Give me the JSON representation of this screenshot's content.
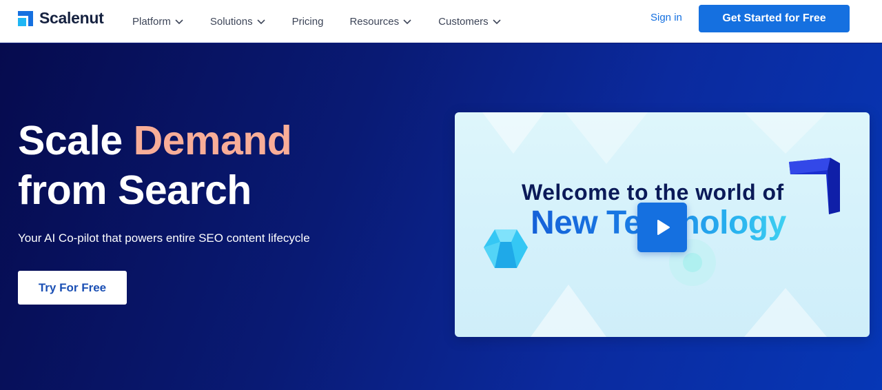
{
  "brand": {
    "name": "Scalenut",
    "logo_icon": "scalenut-logo-icon",
    "primary_color": "#1570e0"
  },
  "nav": {
    "items": [
      {
        "label": "Platform",
        "has_dropdown": true
      },
      {
        "label": "Solutions",
        "has_dropdown": true
      },
      {
        "label": "Pricing",
        "has_dropdown": false
      },
      {
        "label": "Resources",
        "has_dropdown": true
      },
      {
        "label": "Customers",
        "has_dropdown": true
      }
    ],
    "signin_label": "Sign in",
    "cta_label": "Get Started for Free"
  },
  "hero": {
    "headline_part1": "Scale ",
    "headline_accent": "Demand",
    "headline_part2": "from Search",
    "accent_color": "#f8ad98",
    "subheadline": "Your AI Co-pilot that powers entire SEO content lifecycle",
    "button_label": "Try For Free"
  },
  "video": {
    "line1": "Welcome to the world of",
    "line2": "New Technology",
    "play_icon": "play-icon"
  }
}
